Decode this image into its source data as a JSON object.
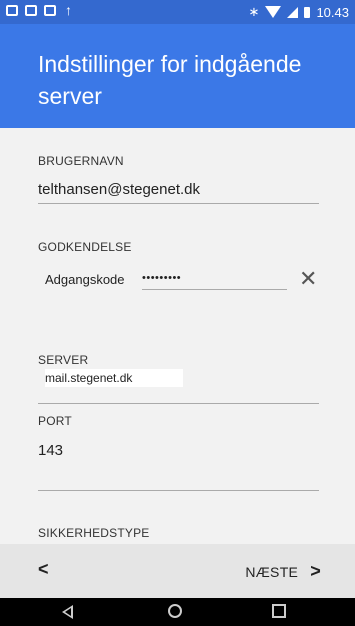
{
  "status_bar": {
    "notification_icons": [
      "mail-icon",
      "image-icon",
      "mail-icon",
      "upload-icon"
    ],
    "right_icons": [
      "bluetooth-icon",
      "wifi-icon",
      "signal-icon",
      "battery-icon"
    ],
    "time": "10.43"
  },
  "header": {
    "title": "Indstillinger for indgående server"
  },
  "form": {
    "username": {
      "label": "BRUGERNAVN",
      "value": "telthansen@stegenet.dk"
    },
    "auth": {
      "label": "GODKENDELSE",
      "password_label": "Adgangskode",
      "password_value": "•••••••••"
    },
    "server": {
      "label": "SERVER",
      "value": "mail.stegenet.dk"
    },
    "port": {
      "label": "PORT",
      "value": "143"
    },
    "security": {
      "label": "SIKKERHEDSTYPE"
    }
  },
  "bottom_bar": {
    "back_label": "<",
    "next_label": "NÆSTE",
    "next_chevron": ">"
  },
  "colors": {
    "accent": "#3b78e7",
    "status_bar": "#3469cf",
    "background": "#f2f2f2"
  }
}
